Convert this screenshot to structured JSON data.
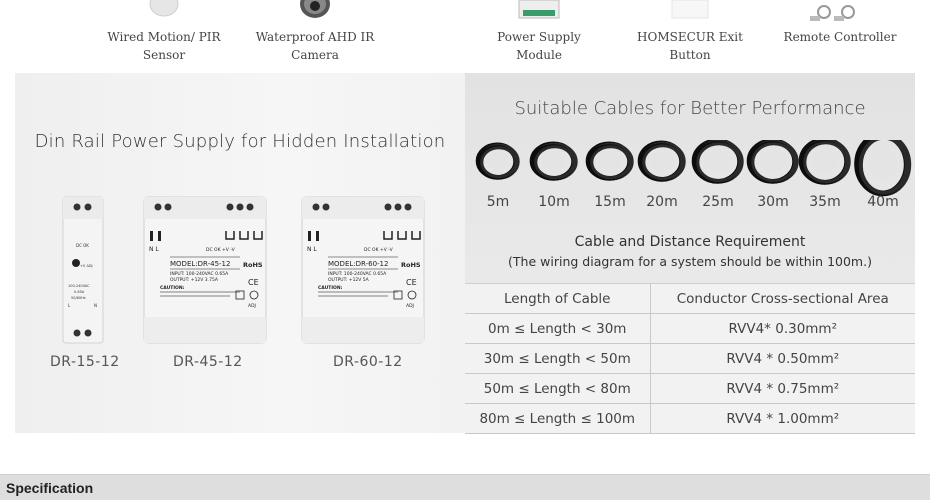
{
  "products": [
    {
      "label": "Wired Motion/ PIR Sensor",
      "icon": "pir-sensor-icon"
    },
    {
      "label": "Waterproof AHD IR Camera",
      "icon": "ir-camera-icon"
    },
    {
      "label": "Power Supply Module",
      "icon": "power-supply-module-icon"
    },
    {
      "label": "HOMSECUR Exit Button",
      "icon": "exit-button-icon"
    },
    {
      "label": "Remote Controller",
      "icon": "remote-controller-icon"
    }
  ],
  "din_rail": {
    "title": "Din Rail Power Supply for Hidden Installation",
    "units": [
      {
        "caption": "DR-15-12",
        "front_text": [
          "DC OK",
          "+V ADJ",
          "100-240VAC",
          "0.65A",
          "50/60Hz",
          "L",
          "N"
        ]
      },
      {
        "caption": "DR-45-12",
        "model": "MODEL:DR-45-12",
        "input": "INPUT:  100-240VAC  0.65A",
        "output": "OUTPUT:    +12V       3.75A",
        "rohs": "RoHS",
        "ce": "CE",
        "adj": "ADJ",
        "caution": "CAUTION:",
        "terminals": "N L",
        "dc_ok": "DC OK  +V    -V"
      },
      {
        "caption": "DR-60-12",
        "model": "MODEL:DR-60-12",
        "input": "INPUT:  100-240VAC  0.65A",
        "output": "OUTPUT:    +12V       5A",
        "rohs": "RoHS",
        "ce": "CE",
        "adj": "ADJ",
        "caution": "CAUTION:",
        "terminals": "N L",
        "dc_ok": "DC OK  +V    -V"
      }
    ]
  },
  "cables": {
    "title": "Suitable Cables for Better Performance",
    "lengths": [
      "5m",
      "10m",
      "15m",
      "20m",
      "25m",
      "30m",
      "35m",
      "40m"
    ],
    "requirement_title": "Cable and Distance Requirement",
    "requirement_subtitle": "(The wiring diagram for a system should be within 100m.)",
    "table": {
      "headers": [
        "Length of Cable",
        "Conductor Cross-sectional Area"
      ],
      "rows": [
        [
          "0m ≤ Length < 30m",
          "RVV4* 0.30mm²"
        ],
        [
          "30m ≤ Length < 50m",
          "RVV4 * 0.50mm²"
        ],
        [
          "50m ≤ Length < 80m",
          "RVV4 * 0.75mm²"
        ],
        [
          "80m ≤ Length ≤ 100m",
          "RVV4 * 1.00mm²"
        ]
      ]
    }
  },
  "specification": {
    "label": "Specification"
  }
}
